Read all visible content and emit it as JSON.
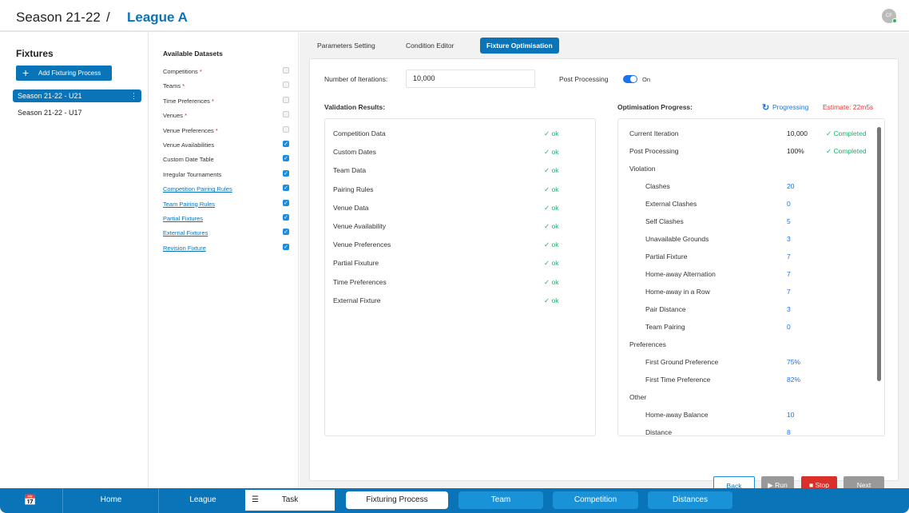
{
  "header": {
    "season": "Season 21-22",
    "separator": "/",
    "league": "League A",
    "avatar": "CF"
  },
  "fixtures": {
    "title": "Fixtures",
    "add_label": "Add Fixturing Process",
    "items": [
      {
        "label": "Season 21-22 - U21",
        "selected": true
      },
      {
        "label": "Season 21-22 - U17",
        "selected": false
      }
    ]
  },
  "datasets": {
    "title": "Available Datasets",
    "items": [
      {
        "label": "Competitions",
        "required": "*",
        "checked": false,
        "link": false
      },
      {
        "label": "Teams",
        "required": "*",
        "checked": false,
        "link": false
      },
      {
        "label": "Time Preferences",
        "required": "*",
        "checked": false,
        "link": false
      },
      {
        "label": "Venues",
        "required": "*",
        "checked": false,
        "link": false
      },
      {
        "label": "Venue Preferences",
        "required": "*",
        "checked": false,
        "link": false
      },
      {
        "label": "Venue Availabilities",
        "checked": true,
        "link": false
      },
      {
        "label": "Custom Date Table",
        "checked": true,
        "link": false
      },
      {
        "label": "Irregular Tournaments",
        "checked": true,
        "link": false
      },
      {
        "label": "Competition Pairing Rules",
        "checked": true,
        "link": true
      },
      {
        "label": "Team Pairing Rules",
        "checked": true,
        "link": true
      },
      {
        "label": "Partial Fixtures",
        "checked": true,
        "link": true
      },
      {
        "label": "External Fixtures",
        "checked": true,
        "link": true
      },
      {
        "label": "Revision Fixture",
        "checked": true,
        "link": true
      }
    ]
  },
  "tabs": [
    {
      "label": "Parameters Setting"
    },
    {
      "label": "Condition Editor"
    },
    {
      "label": "Fixture Optimisation",
      "active": true
    }
  ],
  "params": {
    "iterations_label": "Number of Iterations:",
    "iterations_value": "10,000",
    "post_label": "Post Processing",
    "post_state": "On"
  },
  "validation": {
    "title": "Validation Results:",
    "rows": [
      {
        "label": "Competition Data",
        "status": "ok"
      },
      {
        "label": "Custom Dates",
        "status": "ok"
      },
      {
        "label": "Team Data",
        "status": "ok"
      },
      {
        "label": "Pairing Rules",
        "status": "ok"
      },
      {
        "label": "Venue Data",
        "status": "ok"
      },
      {
        "label": "Venue Availability",
        "status": "ok"
      },
      {
        "label": "Venue Preferences",
        "status": "ok"
      },
      {
        "label": "Partial Fixuture",
        "status": "ok"
      },
      {
        "label": "Time Preferences",
        "status": "ok"
      },
      {
        "label": "External Fixture",
        "status": "ok"
      }
    ]
  },
  "progress": {
    "title": "Optimisation Progress:",
    "state": "Progressing",
    "estimate": "Estimate: 22m5s",
    "rows": [
      {
        "label": "Current Iteration",
        "value": "10,000",
        "status": "Completed",
        "level": 0
      },
      {
        "label": "Post Processing",
        "value": "100%",
        "status": "Completed",
        "level": 0
      },
      {
        "label": "Violation",
        "level": 0
      },
      {
        "label": "Clashes",
        "value": "20",
        "level": 1
      },
      {
        "label": "External Clashes",
        "value": "0",
        "level": 1
      },
      {
        "label": "Self Clashes",
        "value": "5",
        "level": 1
      },
      {
        "label": "Unavailable Grounds",
        "value": "3",
        "level": 1
      },
      {
        "label": "Partial Fixture",
        "value": "7",
        "level": 1
      },
      {
        "label": "Home-away Alternation",
        "value": "7",
        "level": 1
      },
      {
        "label": "Home-away in a Row",
        "value": "7",
        "level": 1
      },
      {
        "label": "Pair Distance",
        "value": "3",
        "level": 1
      },
      {
        "label": "Team Pairing",
        "value": "0",
        "level": 1
      },
      {
        "label": "Preferences",
        "level": 0
      },
      {
        "label": "First Ground Preference",
        "value": "75%",
        "level": 1
      },
      {
        "label": "First Time Preference",
        "value": "82%",
        "level": 1
      },
      {
        "label": "Other",
        "level": 0
      },
      {
        "label": "Home-away Balance",
        "value": "10",
        "level": 1
      },
      {
        "label": "Distance",
        "value": "8",
        "level": 1
      }
    ]
  },
  "actions": {
    "back": "Back",
    "run": "Run",
    "stop": "Stop",
    "next": "Next"
  },
  "nav": {
    "home": "Home",
    "league": "League",
    "task": "Task",
    "fixturing": "Fixturing Process",
    "team": "Team",
    "competition": "Competition",
    "distances": "Distances"
  },
  "colors": {
    "primary": "#0a74b8",
    "ok": "#1fae6e",
    "stop": "#d9302a",
    "estimate": "#e53935"
  }
}
